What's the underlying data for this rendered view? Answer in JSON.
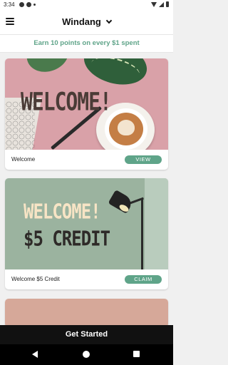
{
  "status_bar": {
    "time": "3:34"
  },
  "header": {
    "title": "Windang"
  },
  "promo": {
    "text": "Earn 10 points on every $1 spent"
  },
  "cards": [
    {
      "label": "Welcome",
      "button": "VIEW",
      "image_text": "WELCOME!"
    },
    {
      "label": "Welcome $5 Credit",
      "button": "CLAIM",
      "image_text_line1": "WELCOME!",
      "image_text_line2": "$5 CREDIT"
    }
  ],
  "footer": {
    "cta": "Get Started"
  },
  "colors": {
    "accent": "#5fa489",
    "header_bg": "#ffffff",
    "cta_bg": "#111111"
  },
  "icons": [
    "menu-icon",
    "chevron-down-icon",
    "wifi-icon",
    "signal-icon",
    "battery-icon",
    "back-icon",
    "home-icon",
    "recents-icon"
  ]
}
